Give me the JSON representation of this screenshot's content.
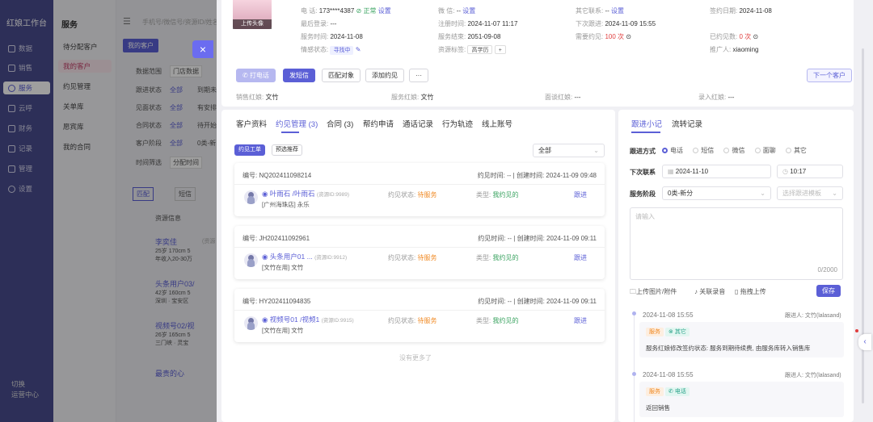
{
  "nav": {
    "brand": "红娘工作台",
    "items": [
      {
        "label": "数据"
      },
      {
        "label": "销售"
      },
      {
        "label": "服务"
      },
      {
        "label": "云呼"
      },
      {
        "label": "财务"
      },
      {
        "label": "记录"
      },
      {
        "label": "管理"
      },
      {
        "label": "设置"
      }
    ],
    "footer_1": "切换",
    "footer_2": "运营中心"
  },
  "side2": {
    "title": "服务",
    "items": [
      "待分配客户",
      "我的客户",
      "约见管理",
      "关单库",
      "愿宾库",
      "我的合同"
    ]
  },
  "bg": {
    "search_placeholder": "手机号/微信号/资源ID/姓名",
    "tab_mine": "我的客户",
    "filters": [
      {
        "label": "数据范围",
        "value": "门店数据"
      },
      {
        "label": "跟进状态",
        "value": "全部",
        "extra": "到期未"
      },
      {
        "label": "见面状态",
        "value": "全部",
        "extra": "有安排"
      },
      {
        "label": "合同状态",
        "value": "全部",
        "extra": "待开始"
      },
      {
        "label": "客户阶段",
        "value": "全部",
        "extra": "0类-新"
      },
      {
        "label": "时间筛选",
        "value": "分配时间"
      }
    ],
    "btn_a": "匹配",
    "btn_b": "短信",
    "list_header": "资源信息",
    "rows": [
      {
        "name": "李奕佳",
        "tag": "(资源",
        "info1": "25岁 170cm 5",
        "info2": "年收入20-30万"
      },
      {
        "name": "头条用户03/",
        "info1": "42岁 160cm 5",
        "info2": "深圳 · 宝安区"
      },
      {
        "name": "视频号02/视",
        "info1": "26岁 165cm 5",
        "info2": "三门峡 · 灵宝"
      },
      {
        "name": "最贵的心"
      }
    ]
  },
  "close_icon": "×",
  "customer": {
    "upload_avatar": "上传头像",
    "phone_label": "电 话:",
    "phone": "173****4387",
    "phone_status": "正常",
    "phone_set": "设置",
    "wechat_label": "微 信:",
    "wechat": "--",
    "wechat_set": "设置",
    "other_label": "其它联系:",
    "other": "--",
    "other_set": "设置",
    "sign_date_label": "签约日期:",
    "sign_date": "2024-11-08",
    "last_login_label": "最后登录:",
    "last_login": "---",
    "register_label": "注册时间:",
    "register": "2024-11-07 11:17",
    "next_follow_label": "下次跟进:",
    "next_follow": "2024-11-09 15:55",
    "service_time_label": "服务时间:",
    "service_time": "2024-11-08",
    "service_end_label": "服务结束:",
    "service_end": "2051-09-08",
    "need_meet_label": "需要约见:",
    "need_meet": "100 次",
    "met_label": "已约见数:",
    "met": "0 次",
    "emotion_label": "情感状态:",
    "emotion": "寻找中",
    "resource_tag_label": "资源标签:",
    "resource_tag": "高学历",
    "promoter_label": "推广人:",
    "promoter": "xiaoming"
  },
  "actions": {
    "call": "打电话",
    "sms": "发短信",
    "match": "匹配对象",
    "add_meet": "添加约见",
    "more": "···",
    "next_customer": "下一个客户"
  },
  "roles": {
    "sales_label": "销售红娘:",
    "sales": "文竹",
    "service_label": "服务红娘:",
    "service": "文竹",
    "interview_label": "面谈红娘:",
    "interview": "---",
    "entry_label": "录入红娘:",
    "entry": "---"
  },
  "tabs": [
    "客户资料",
    "约见管理 (3)",
    "合同 (3)",
    "帮约申请",
    "通话记录",
    "行为轨迹",
    "线上账号"
  ],
  "meet": {
    "subtab_1": "约见工单",
    "subtab_2": "预选推荐",
    "filter": "全部",
    "no_more": "没有更多了",
    "cards": [
      {
        "no": "编号: NQ202411098214",
        "time": "约见时间: -- | 创建时间: 2024-11-09 09:48",
        "name": "叶雨石 /叶雨石",
        "rid": "(资源ID:9989)",
        "shop": "[广州海珠店] 永乐",
        "status_label": "约见状态:",
        "status": "待服务",
        "type_label": "类型:",
        "type": "我约见的",
        "action": "跟进"
      },
      {
        "no": "编号: JH202411092961",
        "time": "约见时间: -- | 创建时间: 2024-11-09 09:11",
        "name": "头条用户01 ...",
        "rid": "(资源ID:9912)",
        "shop": "[文竹在用] 文竹",
        "status_label": "约见状态:",
        "status": "待服务",
        "type_label": "类型:",
        "type": "我约见的",
        "action": "跟进"
      },
      {
        "no": "编号: HY202411094835",
        "time": "约见时间: -- | 创建时间: 2024-11-09 09:11",
        "name": "视频号01 /视频1",
        "rid": "(资源ID:9915)",
        "shop": "[文竹在用] 文竹",
        "status_label": "约见状态:",
        "status": "待服务",
        "type_label": "类型:",
        "type": "我约见的",
        "action": "跟进"
      }
    ]
  },
  "follow": {
    "tab_1": "跟进小记",
    "tab_2": "流转记录",
    "method_label": "跟进方式",
    "methods": [
      "电话",
      "短信",
      "微信",
      "面聊",
      "其它"
    ],
    "next_label": "下次联系",
    "next_date": "2024-11-10",
    "next_time": "10:17",
    "stage_label": "服务阶段",
    "stage": "0类-新分",
    "template_placeholder": "选择跟进模板",
    "textarea_placeholder": "请输入",
    "counter": "0/2000",
    "upload": "上传图片/附件",
    "link_audio": "关联录音",
    "drag_upload": "拖拽上传",
    "save": "保存",
    "logs": [
      {
        "time": "2024-11-08 15:55",
        "by": "跟进人: 文竹(lalasand)",
        "tag1": "服务",
        "tag2": "其它",
        "text": "服务红娘修改签约状态: 服务到期待续费, 由服务库转入销售库"
      },
      {
        "time": "2024-11-08 15:55",
        "by": "跟进人: 文竹(lalasand)",
        "tag1": "服务",
        "tag2": "电话",
        "text": "返回销售"
      }
    ]
  },
  "colors": {
    "primary": "#5b5fd6",
    "nav_bg": "#4a4d8e",
    "warn": "#f08a24",
    "success": "#3aa360",
    "danger": "#e03e3e"
  }
}
